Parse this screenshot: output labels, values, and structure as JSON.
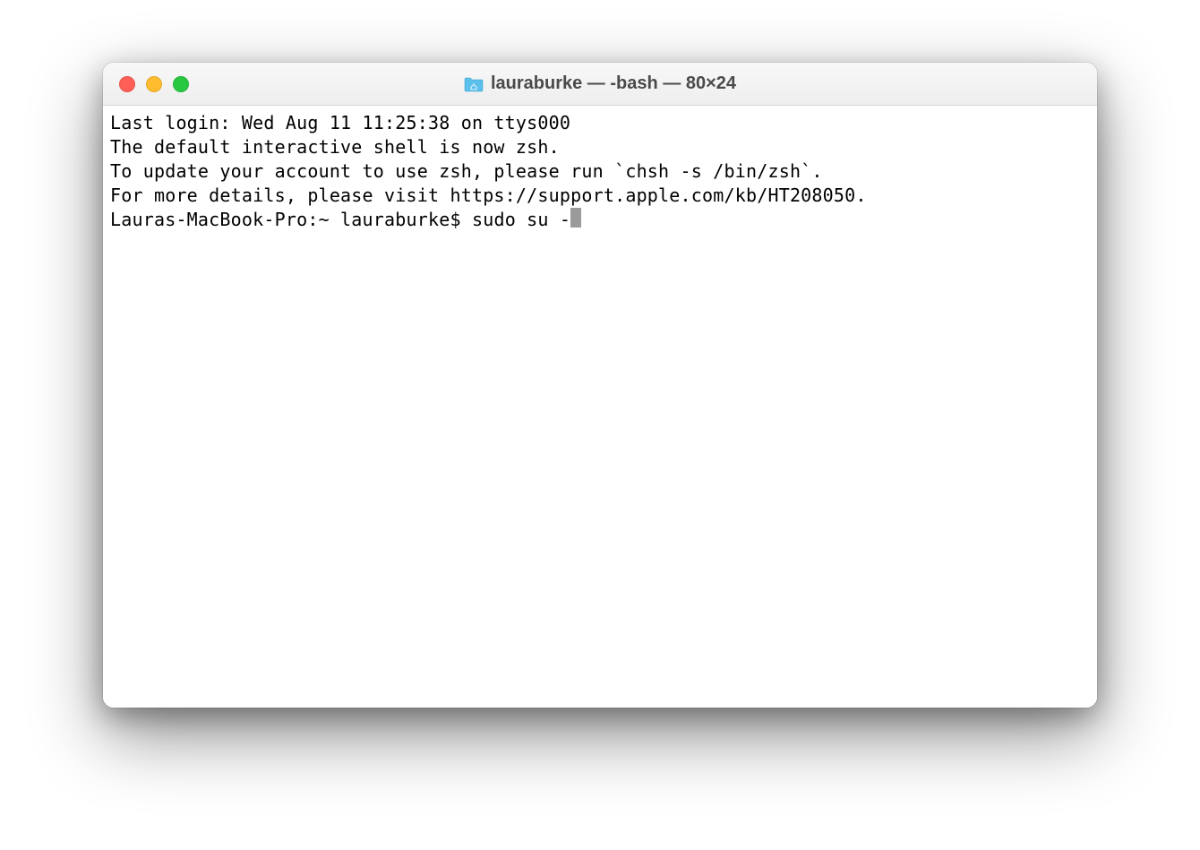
{
  "window": {
    "title": "lauraburke — -bash — 80×24"
  },
  "terminal": {
    "lines": [
      "Last login: Wed Aug 11 11:25:38 on ttys000",
      "",
      "The default interactive shell is now zsh.",
      "To update your account to use zsh, please run `chsh -s /bin/zsh`.",
      "For more details, please visit https://support.apple.com/kb/HT208050."
    ],
    "prompt": "Lauras-MacBook-Pro:~ lauraburke$ ",
    "command": "sudo su -"
  }
}
